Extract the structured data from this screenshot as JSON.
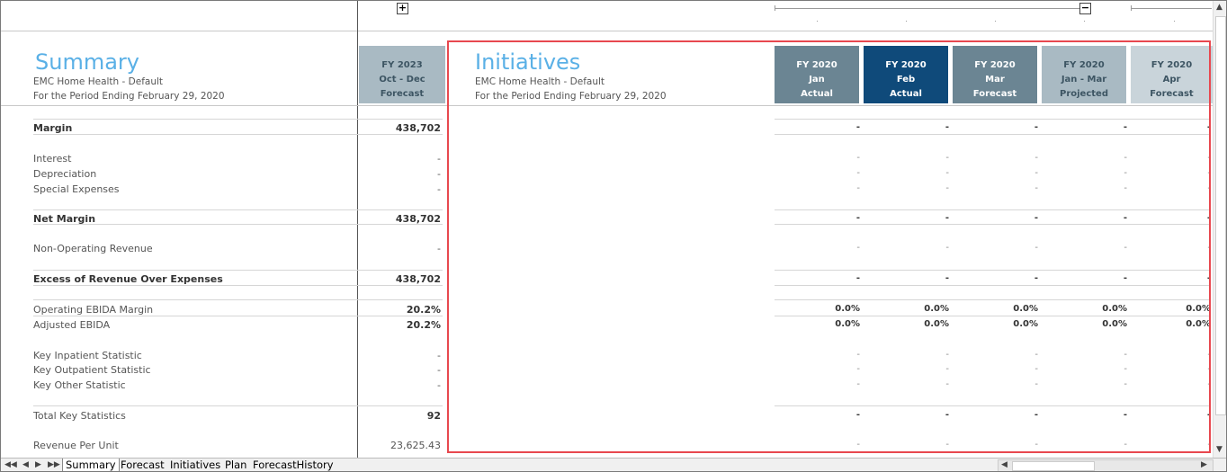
{
  "summary": {
    "title": "Summary",
    "org": "EMC Home Health - Default",
    "period": "For the Period Ending February 29, 2020",
    "fy_header": {
      "line1": "FY 2023",
      "line2": "Oct - Dec",
      "line3": "Forecast"
    }
  },
  "initiatives": {
    "title": "Initiatives",
    "org": "EMC Home Health - Default",
    "period": "For the Period Ending February 29, 2020",
    "columns": [
      {
        "line1": "FY 2020",
        "line2": "Jan",
        "line3": "Actual",
        "bg": "#6b8593",
        "color": "#ffffff"
      },
      {
        "line1": "FY 2020",
        "line2": "Feb",
        "line3": "Actual",
        "bg": "#0f4a7a",
        "color": "#ffffff"
      },
      {
        "line1": "FY 2020",
        "line2": "Mar",
        "line3": "Forecast",
        "bg": "#6b8593",
        "color": "#ffffff"
      },
      {
        "line1": "FY 2020",
        "line2": "Jan - Mar",
        "line3": "Projected",
        "bg": "#a9bac3",
        "color": "#3d5563"
      },
      {
        "line1": "FY 2020",
        "line2": "Apr",
        "line3": "Forecast",
        "bg": "#c9d4da",
        "color": "#3d5563"
      }
    ]
  },
  "rows": [
    {
      "label": "Margin",
      "value": "438,702",
      "bold": true,
      "cells": [
        "-",
        "-",
        "-",
        "-",
        "-"
      ]
    },
    {
      "label": "Interest",
      "value": "-",
      "bold": false,
      "cells": [
        "-",
        "-",
        "-",
        "-",
        "-"
      ]
    },
    {
      "label": "Depreciation",
      "value": "-",
      "bold": false,
      "cells": [
        "-",
        "-",
        "-",
        "-",
        "-"
      ]
    },
    {
      "label": "Special Expenses",
      "value": "-",
      "bold": false,
      "cells": [
        "-",
        "-",
        "-",
        "-",
        "-"
      ]
    },
    {
      "label": "Net Margin",
      "value": "438,702",
      "bold": true,
      "cells": [
        "-",
        "-",
        "-",
        "-",
        "-"
      ]
    },
    {
      "label": "Non-Operating Revenue",
      "value": "-",
      "bold": false,
      "cells": [
        "-",
        "-",
        "-",
        "-",
        "-"
      ]
    },
    {
      "label": "Excess of Revenue Over Expenses",
      "value": "438,702",
      "bold": true,
      "cells": [
        "-",
        "-",
        "-",
        "-",
        "-"
      ]
    },
    {
      "label": "Operating EBIDA Margin",
      "value": "20.2%",
      "bold": false,
      "vbold": true,
      "cells": [
        "0.0%",
        "0.0%",
        "0.0%",
        "0.0%",
        "0.0%"
      ]
    },
    {
      "label": "Adjusted EBIDA",
      "value": "20.2%",
      "bold": false,
      "vbold": true,
      "cells": [
        "0.0%",
        "0.0%",
        "0.0%",
        "0.0%",
        "0.0%"
      ]
    },
    {
      "label": "Key Inpatient Statistic",
      "value": "-",
      "bold": false,
      "cells": [
        "-",
        "-",
        "-",
        "-",
        "-"
      ]
    },
    {
      "label": "Key Outpatient Statistic",
      "value": "-",
      "bold": false,
      "cells": [
        "-",
        "-",
        "-",
        "-",
        "-"
      ]
    },
    {
      "label": "Key Other Statistic",
      "value": "-",
      "bold": false,
      "cells": [
        "-",
        "-",
        "-",
        "-",
        "-"
      ]
    },
    {
      "label": "Total Key Statistics",
      "value": "92",
      "bold": false,
      "vbold": true,
      "cells": [
        "-",
        "-",
        "-",
        "-",
        "-"
      ]
    },
    {
      "label": "Revenue Per Unit",
      "value": "23,625.43",
      "bold": false,
      "cells": [
        "-",
        "-",
        "-",
        "-",
        "-"
      ]
    }
  ],
  "sheet_tabs": [
    "Summary",
    "Forecast",
    "Initiatives",
    "Plan",
    "ForecastHistory"
  ],
  "active_tab": "Summary",
  "group_buttons": {
    "expand": "+",
    "collapse": "−"
  },
  "nav_arrows": [
    "◀◀",
    "◀",
    "▶",
    "▶▶"
  ]
}
